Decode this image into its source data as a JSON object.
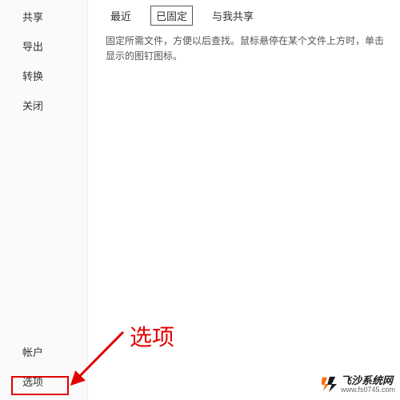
{
  "sidebar": {
    "top": [
      {
        "label": "共享"
      },
      {
        "label": "导出"
      },
      {
        "label": "转换"
      },
      {
        "label": "关闭"
      }
    ],
    "bottom": [
      {
        "label": "帐户"
      },
      {
        "label": "选项"
      }
    ]
  },
  "tabs": [
    {
      "label": "最近",
      "active": false
    },
    {
      "label": "已固定",
      "active": true
    },
    {
      "label": "与我共享",
      "active": false
    }
  ],
  "hint_text": "固定所需文件，方便以后查找。鼠标悬停在某个文件上方时，单击显示的图钉图标。",
  "callout": {
    "label": "选项",
    "arrow_color": "#e10000"
  },
  "watermark": {
    "title": "飞沙系统网",
    "url": "www.fs0745.com"
  }
}
